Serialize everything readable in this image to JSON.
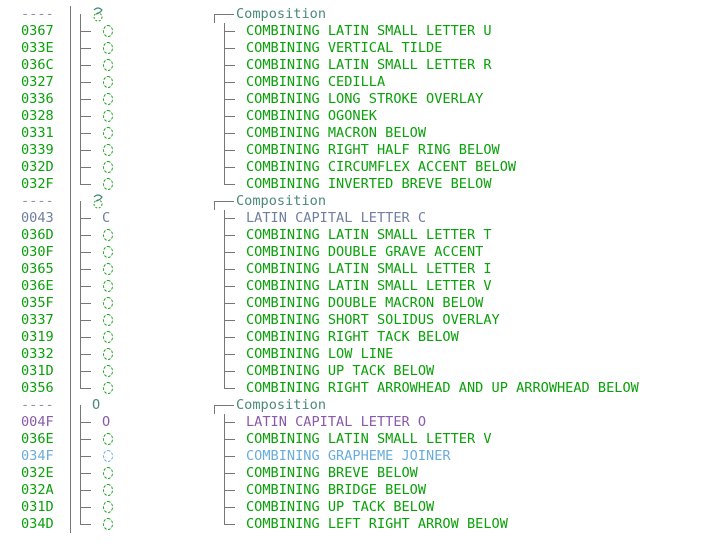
{
  "colors": {
    "combining": "#0aa10a",
    "base_gray": "#7080a0",
    "header": "#4a8a7a",
    "base_purple": "#8a5aaa",
    "joiner": "#6aacdc"
  },
  "groups": [
    {
      "code": "----",
      "header": "Composition",
      "glyph_icon": "composed-glyph-icon",
      "rows": [
        {
          "code": "0367",
          "name": "COMBINING LATIN SMALL LETTER U",
          "kind": "combining"
        },
        {
          "code": "033E",
          "name": "COMBINING VERTICAL TILDE",
          "kind": "combining"
        },
        {
          "code": "036C",
          "name": "COMBINING LATIN SMALL LETTER R",
          "kind": "combining"
        },
        {
          "code": "0327",
          "name": "COMBINING CEDILLA",
          "kind": "combining"
        },
        {
          "code": "0336",
          "name": "COMBINING LONG STROKE OVERLAY",
          "kind": "combining"
        },
        {
          "code": "0328",
          "name": "COMBINING OGONEK",
          "kind": "combining"
        },
        {
          "code": "0331",
          "name": "COMBINING MACRON BELOW",
          "kind": "combining"
        },
        {
          "code": "0339",
          "name": "COMBINING RIGHT HALF RING BELOW",
          "kind": "combining"
        },
        {
          "code": "032D",
          "name": "COMBINING CIRCUMFLEX ACCENT BELOW",
          "kind": "combining"
        },
        {
          "code": "032F",
          "name": "COMBINING INVERTED BREVE BELOW",
          "kind": "combining"
        }
      ]
    },
    {
      "code": "----",
      "header": "Composition",
      "glyph_icon": "composed-glyph-icon",
      "rows": [
        {
          "code": "0043",
          "name": "LATIN CAPITAL LETTER C",
          "kind": "base_gray",
          "glyph": "C"
        },
        {
          "code": "036D",
          "name": "COMBINING LATIN SMALL LETTER T",
          "kind": "combining"
        },
        {
          "code": "030F",
          "name": "COMBINING DOUBLE GRAVE ACCENT",
          "kind": "combining"
        },
        {
          "code": "0365",
          "name": "COMBINING LATIN SMALL LETTER I",
          "kind": "combining"
        },
        {
          "code": "036E",
          "name": "COMBINING LATIN SMALL LETTER V",
          "kind": "combining"
        },
        {
          "code": "035F",
          "name": "COMBINING DOUBLE MACRON BELOW",
          "kind": "combining"
        },
        {
          "code": "0337",
          "name": "COMBINING SHORT SOLIDUS OVERLAY",
          "kind": "combining"
        },
        {
          "code": "0319",
          "name": "COMBINING RIGHT TACK BELOW",
          "kind": "combining"
        },
        {
          "code": "0332",
          "name": "COMBINING LOW LINE",
          "kind": "combining"
        },
        {
          "code": "031D",
          "name": "COMBINING UP TACK BELOW",
          "kind": "combining"
        },
        {
          "code": "0356",
          "name": "COMBINING RIGHT ARROWHEAD AND UP ARROWHEAD BELOW",
          "kind": "combining"
        }
      ]
    },
    {
      "code": "----",
      "header": "Composition",
      "glyph": "O",
      "rows": [
        {
          "code": "004F",
          "name": "LATIN CAPITAL LETTER O",
          "kind": "base_purple",
          "glyph": "O"
        },
        {
          "code": "036E",
          "name": "COMBINING LATIN SMALL LETTER V",
          "kind": "combining"
        },
        {
          "code": "034F",
          "name": "COMBINING GRAPHEME JOINER",
          "kind": "joiner"
        },
        {
          "code": "032E",
          "name": "COMBINING BREVE BELOW",
          "kind": "combining"
        },
        {
          "code": "032A",
          "name": "COMBINING BRIDGE BELOW",
          "kind": "combining"
        },
        {
          "code": "031D",
          "name": "COMBINING UP TACK BELOW",
          "kind": "combining"
        },
        {
          "code": "034D",
          "name": "COMBINING LEFT RIGHT ARROW BELOW",
          "kind": "combining"
        }
      ]
    }
  ]
}
